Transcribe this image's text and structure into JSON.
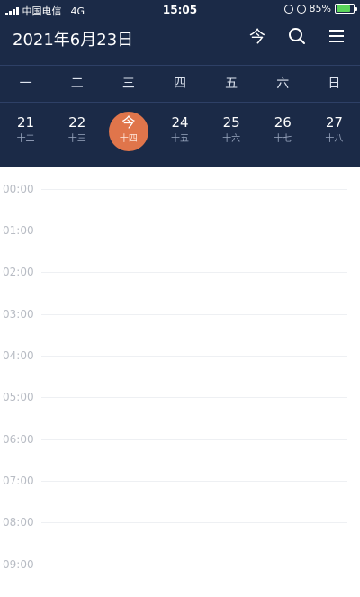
{
  "status_bar": {
    "carrier": "中国电信",
    "network": "4G",
    "time": "15:05",
    "battery": "85%",
    "battery_level": 0.85
  },
  "header": {
    "date_title": "2021年6月23日",
    "today_label": "今"
  },
  "weekdays": [
    "一",
    "二",
    "三",
    "四",
    "五",
    "六",
    "日"
  ],
  "dates": [
    {
      "num": "21",
      "lunar": "十二"
    },
    {
      "num": "22",
      "lunar": "十三"
    },
    {
      "num": "今",
      "lunar": "十四"
    },
    {
      "num": "24",
      "lunar": "十五"
    },
    {
      "num": "25",
      "lunar": "十六"
    },
    {
      "num": "26",
      "lunar": "十七"
    },
    {
      "num": "27",
      "lunar": "十八"
    }
  ],
  "times": [
    "00:00",
    "01:00",
    "02:00",
    "03:00",
    "04:00",
    "05:00",
    "06:00",
    "07:00",
    "08:00",
    "09:00"
  ],
  "colors": {
    "header_bg": "#1b2a47",
    "today_accent": "#e0754b",
    "battery_green": "#5ad45a"
  }
}
